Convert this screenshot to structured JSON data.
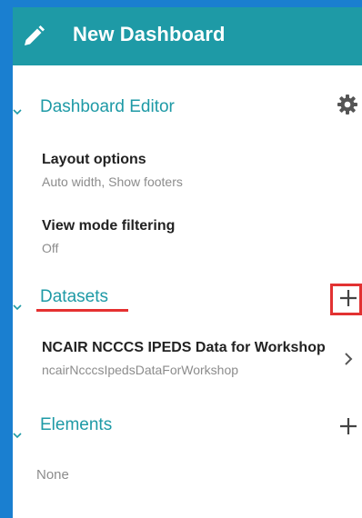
{
  "header": {
    "title": "New Dashboard",
    "icon": "pencil-icon",
    "background": "#1e9aa6"
  },
  "dashboard_editor": {
    "title": "Dashboard Editor",
    "settings_icon": "gear-icon",
    "options": [
      {
        "title": "Layout options",
        "value": "Auto width, Show footers"
      },
      {
        "title": "View mode filtering",
        "value": "Off"
      }
    ]
  },
  "datasets": {
    "title": "Datasets",
    "add_icon": "plus-icon",
    "items": [
      {
        "name": "NCAIR NCCCS IPEDS Data for Workshop",
        "id": "ncairNcccsIpedsDataForWorkshop",
        "icon": "chevron-right-icon"
      }
    ]
  },
  "elements": {
    "title": "Elements",
    "add_icon": "plus-icon",
    "empty_text": "None"
  },
  "colors": {
    "accent": "#1e9aa6",
    "page_border": "#1a7fd0",
    "annotation": "#e23232"
  }
}
